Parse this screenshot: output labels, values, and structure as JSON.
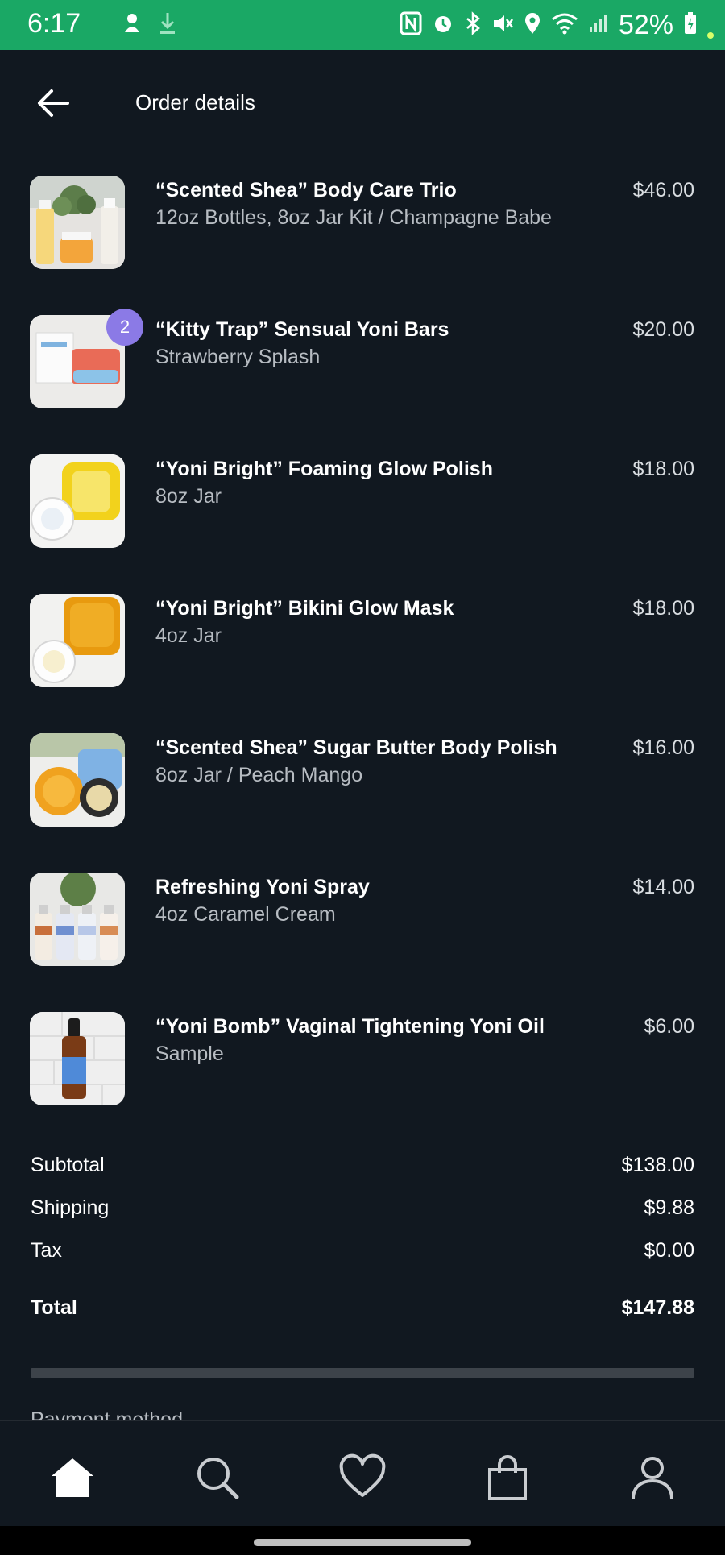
{
  "status_bar": {
    "time": "6:17",
    "battery": "52%",
    "icons": [
      "notification-icon",
      "download-icon",
      "nfc-icon",
      "alarm-icon",
      "bluetooth-icon",
      "mute-icon",
      "location-icon",
      "wifi-icon",
      "signal-icon",
      "battery-icon"
    ]
  },
  "header": {
    "title": "Order details",
    "back_icon": "arrow-left-icon"
  },
  "items": [
    {
      "name": "“Scented Shea” Body Care Trio",
      "variant": "12oz Bottles, 8oz Jar Kit / Champagne Babe",
      "price": "$46.00"
    },
    {
      "name": "“Kitty Trap” Sensual Yoni Bars",
      "variant": "Strawberry Splash",
      "price": "$20.00",
      "quantity": "2"
    },
    {
      "name": "“Yoni Bright” Foaming Glow Polish",
      "variant": "8oz Jar",
      "price": "$18.00"
    },
    {
      "name": "“Yoni Bright” Bikini Glow Mask",
      "variant": "4oz Jar",
      "price": "$18.00"
    },
    {
      "name": "“Scented Shea” Sugar Butter Body Polish",
      "variant": "8oz Jar / Peach Mango",
      "price": "$16.00"
    },
    {
      "name": "Refreshing Yoni Spray",
      "variant": "4oz Caramel Cream",
      "price": "$14.00"
    },
    {
      "name": "“Yoni Bomb” Vaginal Tightening Yoni Oil",
      "variant": "Sample",
      "price": "$6.00"
    }
  ],
  "totals": {
    "subtotal_label": "Subtotal",
    "subtotal": "$138.00",
    "shipping_label": "Shipping",
    "shipping": "$9.88",
    "tax_label": "Tax",
    "tax": "$0.00",
    "total_label": "Total",
    "total": "$147.88"
  },
  "next_section_partial": "Payment method",
  "bottom_nav": {
    "items": [
      "home-icon",
      "search-icon",
      "heart-icon",
      "shopping-bag-icon",
      "profile-icon"
    ]
  },
  "colors": {
    "background": "#111820",
    "status_bar": "#1aa865",
    "badge": "#8b7ae6",
    "secondary_text": "#b7bcc2"
  }
}
